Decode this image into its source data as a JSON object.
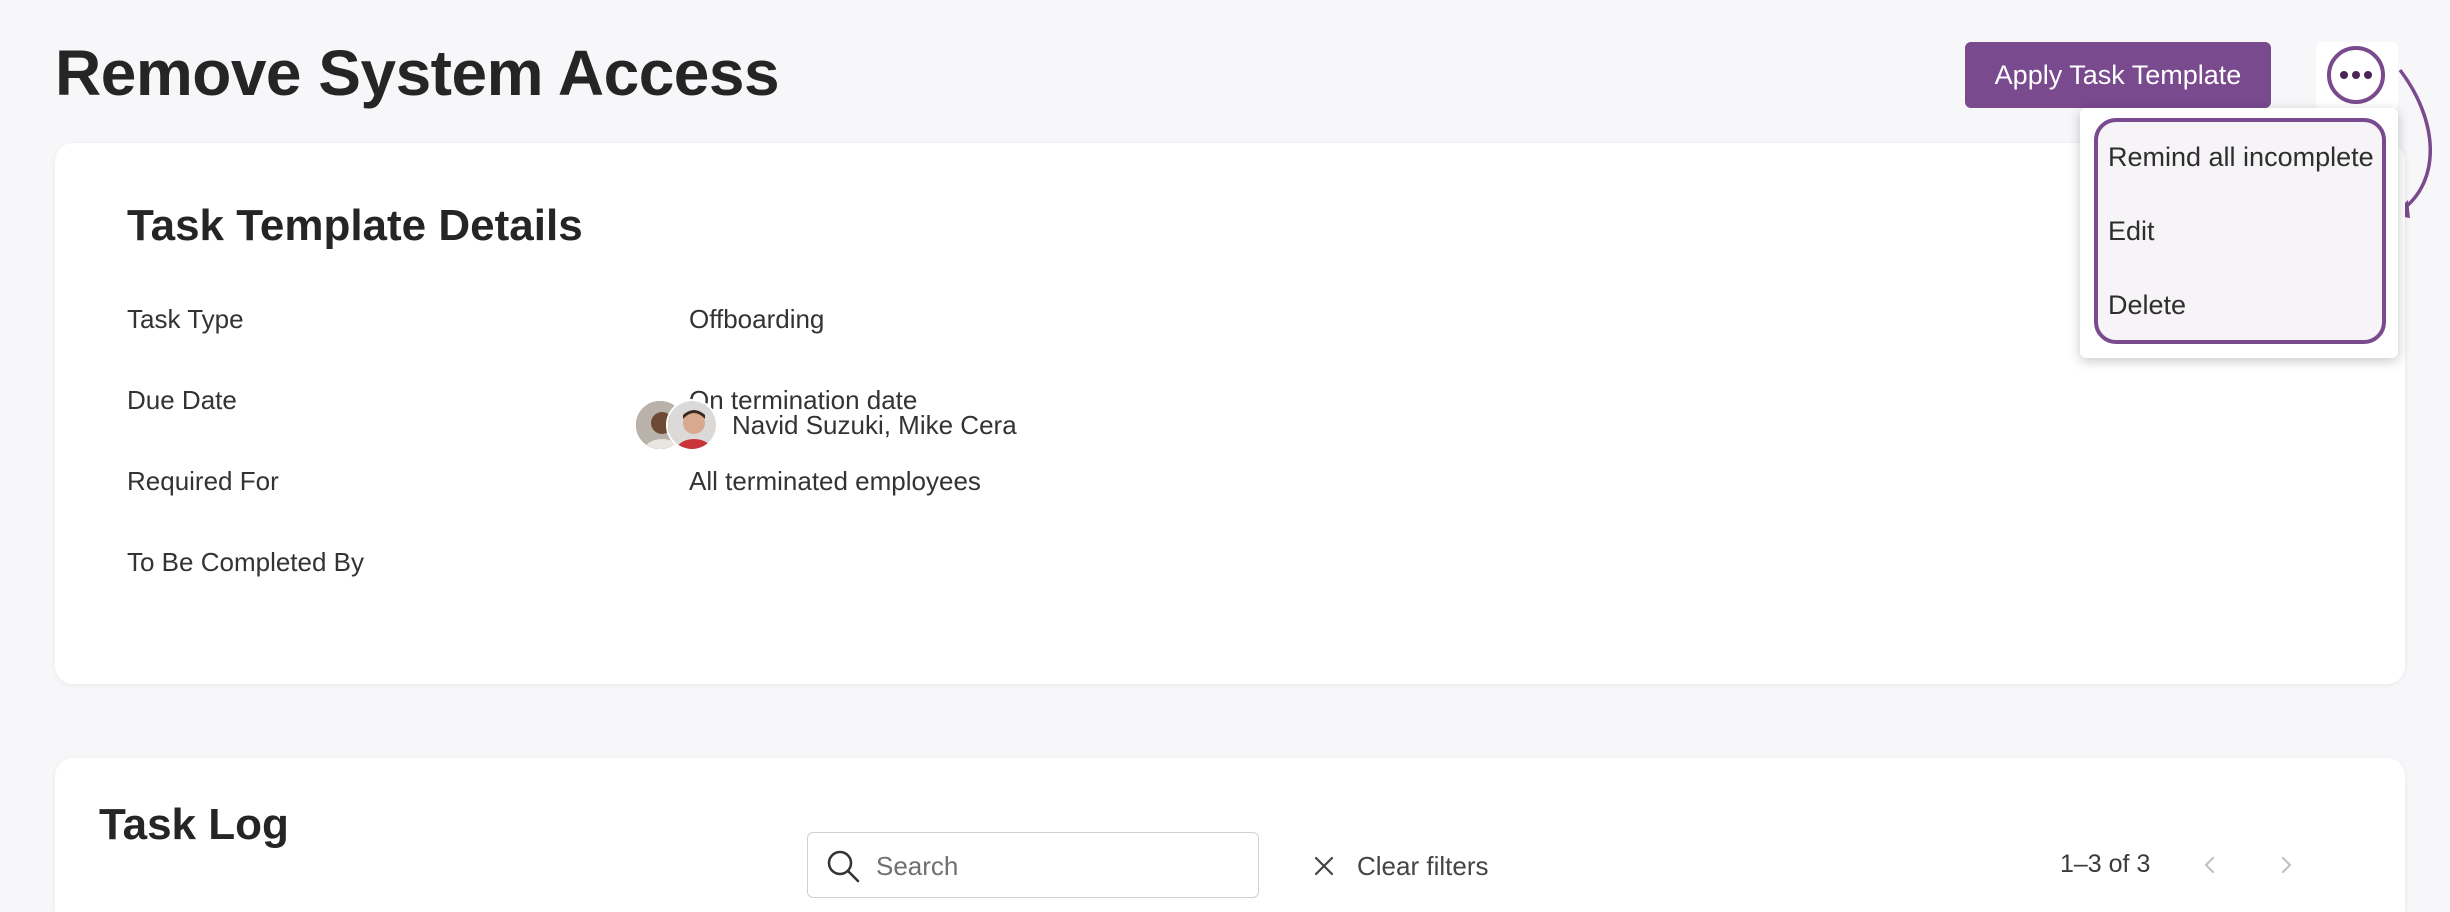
{
  "header": {
    "title": "Remove System Access",
    "apply_button": "Apply Task Template",
    "more_icon": "ellipsis-horizontal-icon"
  },
  "menu": {
    "items": [
      {
        "label": "Remind all incomplete"
      },
      {
        "label": "Edit"
      },
      {
        "label": "Delete"
      }
    ]
  },
  "details": {
    "title": "Task Template Details",
    "rows": [
      {
        "label": "Task Type",
        "value": "Offboarding"
      },
      {
        "label": "Due Date",
        "value": "On termination date"
      },
      {
        "label": "Required For",
        "value": "All terminated employees"
      },
      {
        "label": "To Be Completed By",
        "value": "Navid Suzuki, Mike Cera"
      }
    ]
  },
  "task_log": {
    "title": "Task Log",
    "search_placeholder": "Search",
    "clear_filters": "Clear filters",
    "pagination": "1–3 of 3"
  },
  "colors": {
    "accent": "#7a4a8e",
    "background": "#f7f7f9",
    "card": "#ffffff"
  }
}
